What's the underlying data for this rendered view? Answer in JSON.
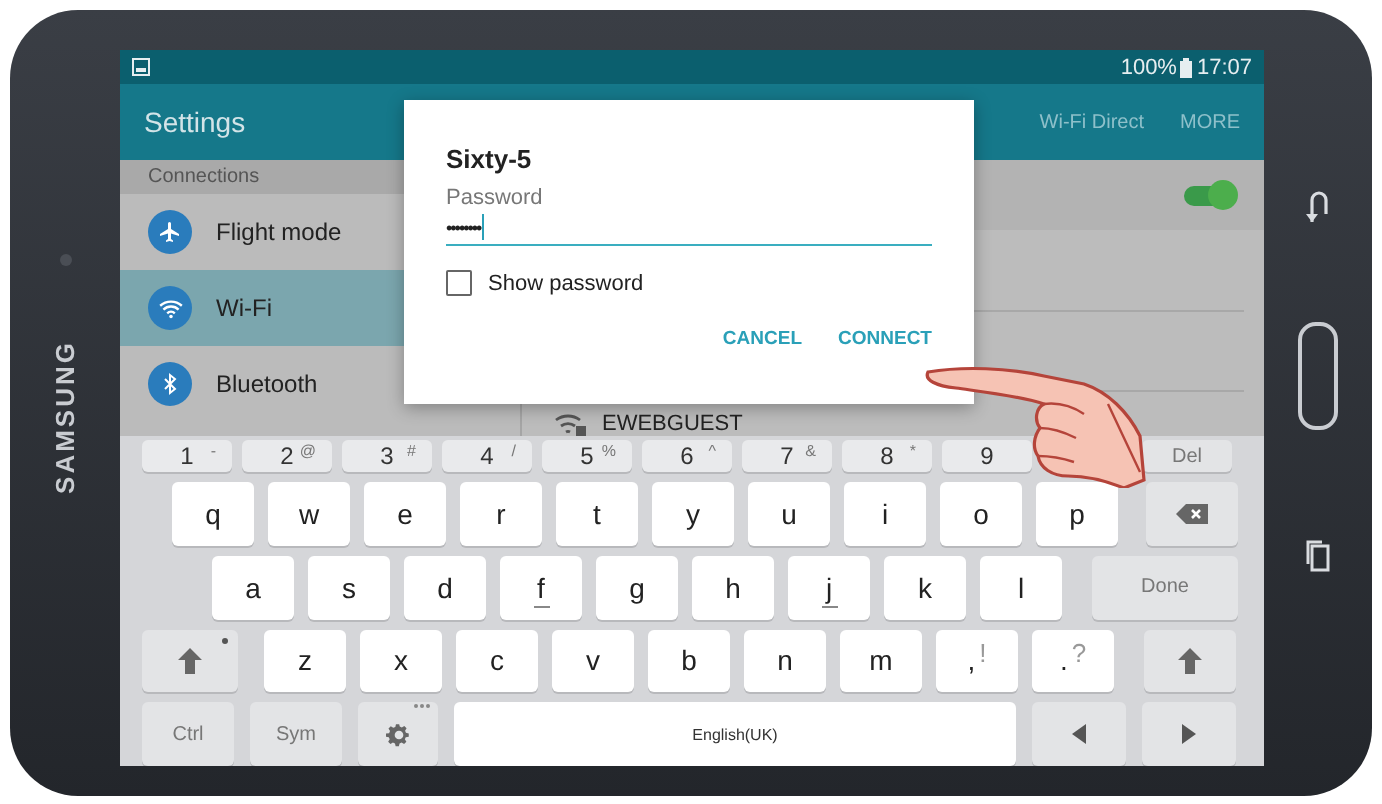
{
  "device": {
    "brand": "SAMSUNG"
  },
  "status_bar": {
    "battery": "100%",
    "time": "17:07"
  },
  "header": {
    "title": "Settings",
    "actions": [
      "Wi-Fi Direct",
      "MORE"
    ]
  },
  "sidebar": {
    "section": "Connections",
    "items": [
      {
        "label": "Flight mode",
        "kind": "airplane",
        "selected": false
      },
      {
        "label": "Wi-Fi",
        "kind": "wifi",
        "selected": true
      },
      {
        "label": "Bluetooth",
        "kind": "bluetooth",
        "selected": false
      }
    ]
  },
  "wifi": {
    "on": true,
    "networks": [
      {
        "name": "EWEBGUEST"
      }
    ]
  },
  "dialog": {
    "title": "Sixty-5",
    "field": {
      "label": "Password",
      "value": "••••••••"
    },
    "show_password": {
      "label": "Show password",
      "checked": false
    },
    "buttons": [
      "CANCEL",
      "CONNECT"
    ]
  },
  "keyboard": {
    "rows": [
      [
        {
          "kind": "number",
          "label": "1",
          "alt": "-"
        },
        {
          "kind": "number",
          "label": "2",
          "alt": "@"
        },
        {
          "kind": "number",
          "label": "3",
          "alt": "#"
        },
        {
          "kind": "number",
          "label": "4",
          "alt": "/"
        },
        {
          "kind": "number",
          "label": "5",
          "alt": "%"
        },
        {
          "kind": "number",
          "label": "6",
          "alt": "^"
        },
        {
          "kind": "number",
          "label": "7",
          "alt": "&"
        },
        {
          "kind": "number",
          "label": "8",
          "alt": "*"
        },
        {
          "kind": "number",
          "label": "9"
        },
        {
          "kind": "hidden"
        },
        {
          "kind": "text",
          "label": "Del"
        }
      ],
      [
        {
          "kind": "letter",
          "label": "q"
        },
        {
          "kind": "letter",
          "label": "w"
        },
        {
          "kind": "letter",
          "label": "e"
        },
        {
          "kind": "letter",
          "label": "r"
        },
        {
          "kind": "letter",
          "label": "t"
        },
        {
          "kind": "letter",
          "label": "y"
        },
        {
          "kind": "letter",
          "label": "u"
        },
        {
          "kind": "letter",
          "label": "i"
        },
        {
          "kind": "letter",
          "label": "o"
        },
        {
          "kind": "letter",
          "label": "p"
        },
        {
          "kind": "backspace"
        }
      ],
      [
        {
          "kind": "letter",
          "label": "a"
        },
        {
          "kind": "letter",
          "label": "s"
        },
        {
          "kind": "letter",
          "label": "d"
        },
        {
          "kind": "letter",
          "label": "f",
          "bump": true
        },
        {
          "kind": "letter",
          "label": "g"
        },
        {
          "kind": "letter",
          "label": "h"
        },
        {
          "kind": "letter",
          "label": "j",
          "bump": true
        },
        {
          "kind": "letter",
          "label": "k"
        },
        {
          "kind": "letter",
          "label": "l"
        },
        {
          "kind": "done",
          "label": "Done"
        }
      ],
      [
        {
          "kind": "shift"
        },
        {
          "kind": "letter",
          "label": "z"
        },
        {
          "kind": "letter",
          "label": "x"
        },
        {
          "kind": "letter",
          "label": "c"
        },
        {
          "kind": "letter",
          "label": "v"
        },
        {
          "kind": "letter",
          "label": "b"
        },
        {
          "kind": "letter",
          "label": "n"
        },
        {
          "kind": "letter",
          "label": "m"
        },
        {
          "kind": "letter",
          "label": ",",
          "alt": "!"
        },
        {
          "kind": "letter",
          "label": ".",
          "alt": "?"
        },
        {
          "kind": "shift"
        }
      ],
      [
        {
          "kind": "text",
          "label": "Ctrl"
        },
        {
          "kind": "text",
          "label": "Sym"
        },
        {
          "kind": "settings"
        },
        {
          "kind": "space",
          "label": "English(UK)"
        },
        {
          "kind": "left"
        },
        {
          "kind": "right"
        }
      ]
    ]
  }
}
